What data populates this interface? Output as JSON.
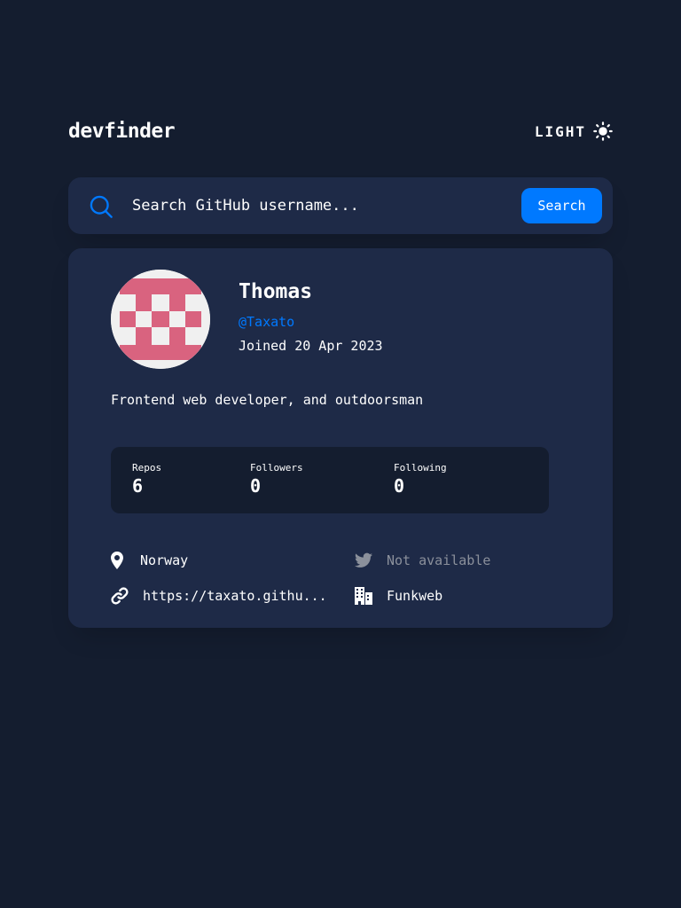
{
  "header": {
    "logo": "devfinder",
    "theme_toggle_label": "LIGHT",
    "theme_icon": "sun-icon"
  },
  "search": {
    "placeholder": "Search GitHub username...",
    "value": "",
    "button_label": "Search",
    "icon": "search-icon"
  },
  "profile": {
    "name": "Thomas",
    "login": "@Taxato",
    "joined": "Joined 20 Apr 2023",
    "bio": "Frontend web developer, and outdoorsman",
    "avatar_color": "#d9637f"
  },
  "stats": {
    "repos_label": "Repos",
    "repos_value": "6",
    "followers_label": "Followers",
    "followers_value": "0",
    "following_label": "Following",
    "following_value": "0"
  },
  "links": {
    "location": "Norway",
    "twitter": "Not available",
    "blog": "https://taxato.githu...",
    "company": "Funkweb"
  },
  "colors": {
    "background": "#141d2f",
    "card": "#1e2a47",
    "accent": "#0079ff",
    "muted": "#8b909b",
    "text": "#ffffff"
  }
}
